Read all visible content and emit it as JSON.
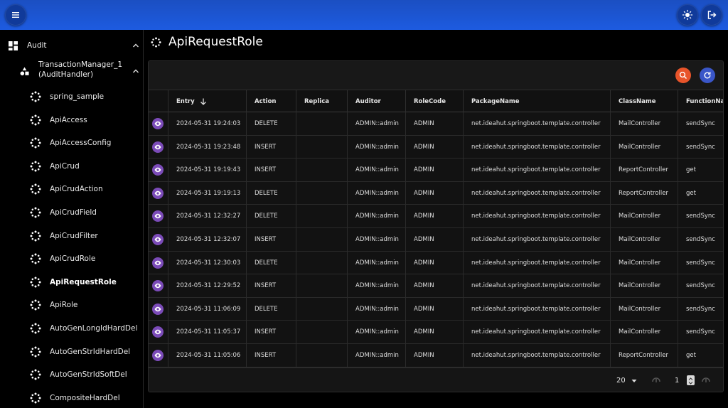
{
  "topbar": {
    "menu_icon": "hamburger-menu-icon",
    "theme_icon": "sun-icon",
    "logout_icon": "logout-icon"
  },
  "sidebar": {
    "group": {
      "label": "Audit",
      "icon": "dashboard-icon"
    },
    "subgroup": {
      "label_line1": "TransactionManager_1",
      "label_line2": "(AuditHandler)",
      "icon": "shapes-icon"
    },
    "items": [
      {
        "label": "spring_sample",
        "active": false
      },
      {
        "label": "ApiAccess",
        "active": false
      },
      {
        "label": "ApiAccessConfig",
        "active": false
      },
      {
        "label": "ApiCrud",
        "active": false
      },
      {
        "label": "ApiCrudAction",
        "active": false
      },
      {
        "label": "ApiCrudField",
        "active": false
      },
      {
        "label": "ApiCrudFilter",
        "active": false
      },
      {
        "label": "ApiCrudRole",
        "active": false
      },
      {
        "label": "ApiRequestRole",
        "active": true
      },
      {
        "label": "ApiRole",
        "active": false
      },
      {
        "label": "AutoGenLongIdHardDel",
        "active": false
      },
      {
        "label": "AutoGenStrIdHardDel",
        "active": false
      },
      {
        "label": "AutoGenStrIdSoftDel",
        "active": false
      },
      {
        "label": "CompositeHardDel",
        "active": false
      }
    ]
  },
  "page": {
    "title": "ApiRequestRole"
  },
  "grid": {
    "toolbar": {
      "search_icon": "search-icon",
      "refresh_icon": "refresh-icon",
      "search_color": "#e8542a",
      "refresh_color": "#3a56c8"
    },
    "columns": [
      {
        "key": "entry",
        "label": "Entry"
      },
      {
        "key": "action",
        "label": "Action"
      },
      {
        "key": "replica",
        "label": "Replica"
      },
      {
        "key": "auditor",
        "label": "Auditor"
      },
      {
        "key": "rolecode",
        "label": "RoleCode"
      },
      {
        "key": "package",
        "label": "PackageName"
      },
      {
        "key": "class",
        "label": "ClassName"
      },
      {
        "key": "function",
        "label": "FunctionNar"
      }
    ],
    "rows": [
      {
        "entry": "2024-05-31 19:24:03",
        "action": "DELETE",
        "replica": "",
        "auditor": "ADMIN::admin",
        "rolecode": "ADMIN",
        "package": "net.ideahut.springboot.template.controller",
        "class": "MailController",
        "function": "sendSync"
      },
      {
        "entry": "2024-05-31 19:23:48",
        "action": "INSERT",
        "replica": "",
        "auditor": "ADMIN::admin",
        "rolecode": "ADMIN",
        "package": "net.ideahut.springboot.template.controller",
        "class": "MailController",
        "function": "sendSync"
      },
      {
        "entry": "2024-05-31 19:19:43",
        "action": "INSERT",
        "replica": "",
        "auditor": "ADMIN::admin",
        "rolecode": "ADMIN",
        "package": "net.ideahut.springboot.template.controller",
        "class": "ReportController",
        "function": "get"
      },
      {
        "entry": "2024-05-31 19:19:13",
        "action": "DELETE",
        "replica": "",
        "auditor": "ADMIN::admin",
        "rolecode": "ADMIN",
        "package": "net.ideahut.springboot.template.controller",
        "class": "ReportController",
        "function": "get"
      },
      {
        "entry": "2024-05-31 12:32:27",
        "action": "DELETE",
        "replica": "",
        "auditor": "ADMIN::admin",
        "rolecode": "ADMIN",
        "package": "net.ideahut.springboot.template.controller",
        "class": "MailController",
        "function": "sendSync"
      },
      {
        "entry": "2024-05-31 12:32:07",
        "action": "INSERT",
        "replica": "",
        "auditor": "ADMIN::admin",
        "rolecode": "ADMIN",
        "package": "net.ideahut.springboot.template.controller",
        "class": "MailController",
        "function": "sendSync"
      },
      {
        "entry": "2024-05-31 12:30:03",
        "action": "DELETE",
        "replica": "",
        "auditor": "ADMIN::admin",
        "rolecode": "ADMIN",
        "package": "net.ideahut.springboot.template.controller",
        "class": "MailController",
        "function": "sendSync"
      },
      {
        "entry": "2024-05-31 12:29:52",
        "action": "INSERT",
        "replica": "",
        "auditor": "ADMIN::admin",
        "rolecode": "ADMIN",
        "package": "net.ideahut.springboot.template.controller",
        "class": "MailController",
        "function": "sendSync"
      },
      {
        "entry": "2024-05-31 11:06:09",
        "action": "DELETE",
        "replica": "",
        "auditor": "ADMIN::admin",
        "rolecode": "ADMIN",
        "package": "net.ideahut.springboot.template.controller",
        "class": "MailController",
        "function": "sendSync"
      },
      {
        "entry": "2024-05-31 11:05:37",
        "action": "INSERT",
        "replica": "",
        "auditor": "ADMIN::admin",
        "rolecode": "ADMIN",
        "package": "net.ideahut.springboot.template.controller",
        "class": "MailController",
        "function": "sendSync"
      },
      {
        "entry": "2024-05-31 11:05:06",
        "action": "INSERT",
        "replica": "",
        "auditor": "ADMIN::admin",
        "rolecode": "ADMIN",
        "package": "net.ideahut.springboot.template.controller",
        "class": "ReportController",
        "function": "get"
      }
    ],
    "pagination": {
      "page_size": "20",
      "page_number": "1"
    }
  },
  "colors": {
    "topbar": "#1d55d6",
    "view_button": "#7b4bb8",
    "background": "#000000"
  }
}
